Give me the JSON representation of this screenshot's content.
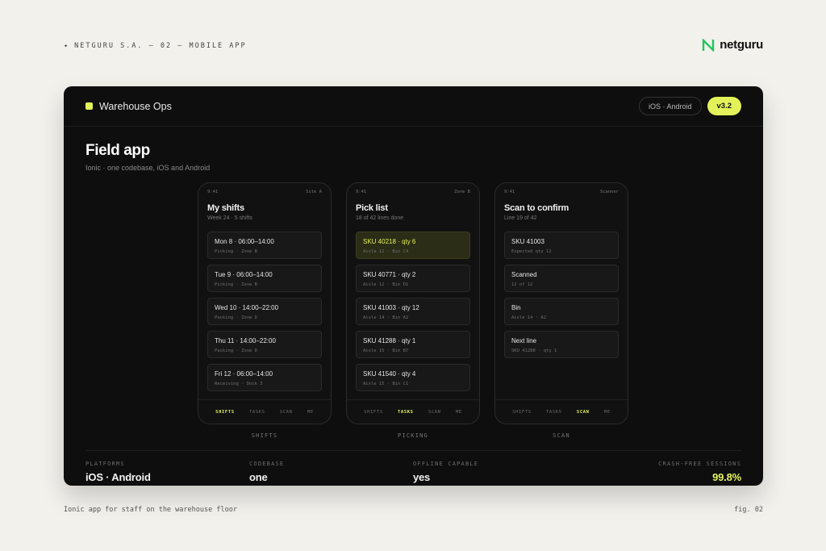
{
  "caption": "NETGURU S.A. — 02 — MOBILE APP",
  "brand": {
    "name": "netguru",
    "logo_icon": "netguru-n-logo",
    "color": "#22c55e"
  },
  "header": {
    "app_name": "Warehouse Ops",
    "platforms_pill": "iOS · Android",
    "version_pill": "v3.2"
  },
  "page": {
    "title": "Field app",
    "subtitle": "Ionic · one codebase, iOS and Android"
  },
  "colors": {
    "accent": "#e3f25a",
    "background": "#0e0e0e"
  },
  "phones": [
    {
      "time": "9:41",
      "status_right": "Site A",
      "title": "My shifts",
      "subtitle": "Week 24 · 5 shifts",
      "cards": [
        {
          "title": "Mon 8 · 06:00–14:00",
          "sub": "Picking · Zone B"
        },
        {
          "title": "Tue 9 · 06:00–14:00",
          "sub": "Picking · Zone B"
        },
        {
          "title": "Wed 10 · 14:00–22:00",
          "sub": "Packing · Zone D"
        },
        {
          "title": "Thu 11 · 14:00–22:00",
          "sub": "Packing · Zone D"
        },
        {
          "title": "Fri 12 · 06:00–14:00",
          "sub": "Receiving · Dock 3"
        }
      ],
      "tabs": [
        "SHIFTS",
        "TASKS",
        "SCAN",
        "ME"
      ],
      "active_tab": 0,
      "caption": "SHIFTS"
    },
    {
      "time": "9:41",
      "status_right": "Zone B",
      "title": "Pick list",
      "subtitle": "18 of 42 lines done",
      "cards": [
        {
          "title": "SKU 40218 · qty 6",
          "sub": "Aisle 12 · Bin C4",
          "active": true
        },
        {
          "title": "SKU 40771 · qty 2",
          "sub": "Aisle 12 · Bin D1"
        },
        {
          "title": "SKU 41003 · qty 12",
          "sub": "Aisle 14 · Bin A2"
        },
        {
          "title": "SKU 41288 · qty 1",
          "sub": "Aisle 15 · Bin B7"
        },
        {
          "title": "SKU 41540 · qty 4",
          "sub": "Aisle 15 · Bin C1"
        }
      ],
      "tabs": [
        "SHIFTS",
        "TASKS",
        "SCAN",
        "ME"
      ],
      "active_tab": 1,
      "caption": "PICKING"
    },
    {
      "time": "9:41",
      "status_right": "Scanner",
      "title": "Scan to confirm",
      "subtitle": "Line 19 of 42",
      "cards": [
        {
          "title": "SKU 41003",
          "sub": "Expected qty 12"
        },
        {
          "title": "Scanned",
          "sub": "12 of 12"
        },
        {
          "title": "Bin",
          "sub": "Aisle 14 · A2"
        },
        {
          "title": "Next line",
          "sub": "SKU 41288 · qty 1"
        }
      ],
      "tabs": [
        "SHIFTS",
        "TASKS",
        "SCAN",
        "ME"
      ],
      "active_tab": 2,
      "caption": "SCAN"
    }
  ],
  "stats": [
    {
      "label": "PLATFORMS",
      "value": "iOS · Android"
    },
    {
      "label": "CODEBASE",
      "value": "one"
    },
    {
      "label": "OFFLINE CAPABLE",
      "value": "yes"
    },
    {
      "label": "CRASH-FREE SESSIONS",
      "value": "99.8%"
    }
  ],
  "footer": {
    "left": "Ionic app for staff on the warehouse floor",
    "right": "fig. 02"
  }
}
